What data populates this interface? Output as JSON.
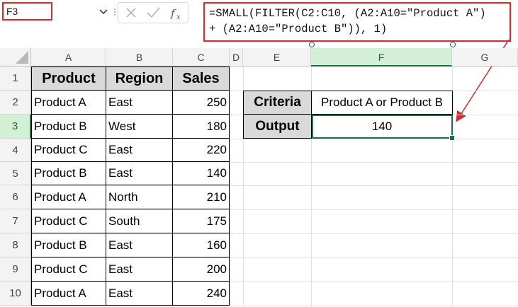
{
  "namebox": {
    "value": "F3"
  },
  "formula_bar": {
    "line1": "=SMALL(FILTER(C2:C10, (A2:A10=\"Product A\")",
    "line2": "+ (A2:A10=\"Product B\")), 1)"
  },
  "columns": [
    "A",
    "B",
    "C",
    "D",
    "E",
    "F",
    "G"
  ],
  "rows": [
    "1",
    "2",
    "3",
    "4",
    "5",
    "6",
    "7",
    "8",
    "9",
    "10"
  ],
  "table": {
    "headers": [
      "Product",
      "Region",
      "Sales"
    ],
    "rows": [
      [
        "Product A",
        "East",
        "250"
      ],
      [
        "Product B",
        "West",
        "180"
      ],
      [
        "Product C",
        "East",
        "220"
      ],
      [
        "Product B",
        "East",
        "140"
      ],
      [
        "Product A",
        "North",
        "210"
      ],
      [
        "Product C",
        "South",
        "175"
      ],
      [
        "Product B",
        "East",
        "160"
      ],
      [
        "Product C",
        "East",
        "200"
      ],
      [
        "Product A",
        "East",
        "240"
      ]
    ]
  },
  "criteria_box": {
    "criteria_label": "Criteria",
    "criteria_value": "Product A or Product B",
    "output_label": "Output",
    "output_value": "140"
  },
  "colors": {
    "highlight_red": "#e0262a",
    "selection_green": "#1e7145",
    "header_fill": "#d9d9d9"
  }
}
